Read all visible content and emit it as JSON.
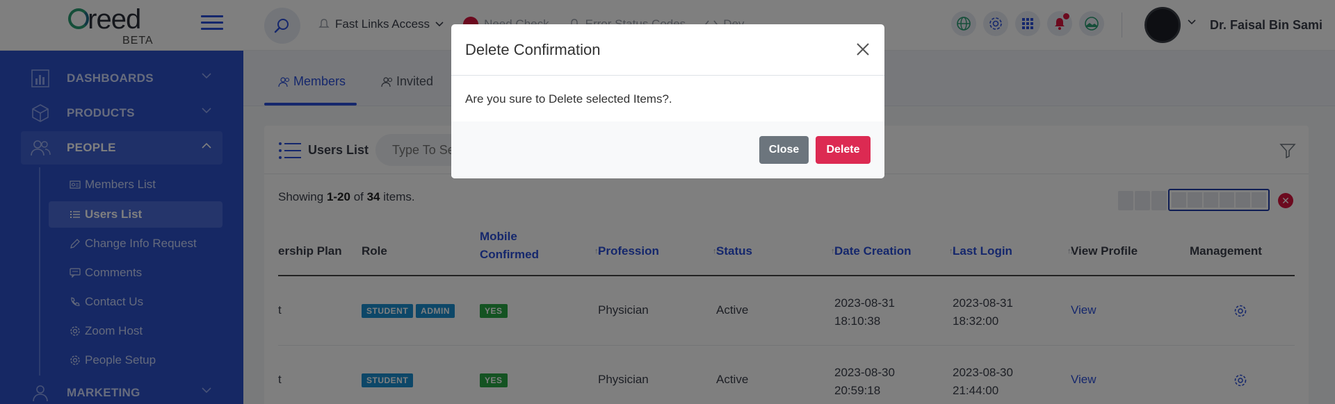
{
  "header": {
    "brand": "reed",
    "beta": "BETA",
    "nav": [
      {
        "label": "Fast Links Access",
        "icon": "bell-outline-icon",
        "faded": false
      },
      {
        "label": "Need Check",
        "icon": "red-badge-icon",
        "faded": true
      },
      {
        "label": "Error Status Codes",
        "icon": "bell-outline-icon",
        "faded": true
      },
      {
        "label": "Dev",
        "icon": "code-icon",
        "faded": true
      }
    ],
    "username": "Dr. Faisal Bin Sami"
  },
  "sidebar": {
    "sections": [
      {
        "label": "DASHBOARDS",
        "icon": "bar-chart-icon"
      },
      {
        "label": "PRODUCTS",
        "icon": "box-icon"
      },
      {
        "label": "PEOPLE",
        "icon": "people-icon"
      },
      {
        "label": "MARKETING",
        "icon": "megaphone-icon"
      }
    ],
    "people_items": [
      {
        "label": "Members List",
        "icon": "id-card-icon"
      },
      {
        "label": "Users List",
        "icon": "list-icon"
      },
      {
        "label": "Change Info Request",
        "icon": "pencil-icon"
      },
      {
        "label": "Comments",
        "icon": "comment-icon"
      },
      {
        "label": "Contact Us",
        "icon": "phone-icon"
      },
      {
        "label": "Zoom Host",
        "icon": "gear-icon"
      },
      {
        "label": "People Setup",
        "icon": "gear-icon"
      }
    ]
  },
  "tabs": [
    {
      "label": "Members"
    },
    {
      "label": "Invited"
    }
  ],
  "card": {
    "title": "Users List",
    "search_placeholder": "Type To Search",
    "showing_prefix": "Showing ",
    "showing_range": "1-20",
    "showing_of": " of ",
    "showing_total": "34",
    "showing_suffix": " items."
  },
  "table": {
    "headers": {
      "plan": "ership Plan",
      "role": "Role",
      "mobile": "Mobile Confirmed",
      "profession": "Profession",
      "status": "Status",
      "date_creation": "Date Creation",
      "last_login": "Last Login",
      "view_profile": "View Profile",
      "management": "Management"
    },
    "rows": [
      {
        "plan": "t",
        "roles": [
          "STUDENT",
          "ADMIN"
        ],
        "mobile": "YES",
        "profession": "Physician",
        "status": "Active",
        "date_creation_date": "2023-08-31",
        "date_creation_time": "18:10:38",
        "last_login_date": "2023-08-31",
        "last_login_time": "18:32:00",
        "view": "View"
      },
      {
        "plan": "t",
        "roles": [
          "STUDENT"
        ],
        "mobile": "YES",
        "profession": "Physician",
        "status": "Active",
        "date_creation_date": "2023-08-30",
        "date_creation_time": "20:59:18",
        "last_login_date": "2023-08-30",
        "last_login_time": "21:44:00",
        "view": "View"
      }
    ]
  },
  "modal": {
    "title": "Delete Confirmation",
    "message": "Are you sure to Delete selected Items?.",
    "close_label": "Close",
    "delete_label": "Delete"
  },
  "colors": {
    "sidebar": "#2c50c9",
    "accent": "#2b4fd8",
    "danger": "#dc2a52",
    "secondary": "#6c757d"
  }
}
